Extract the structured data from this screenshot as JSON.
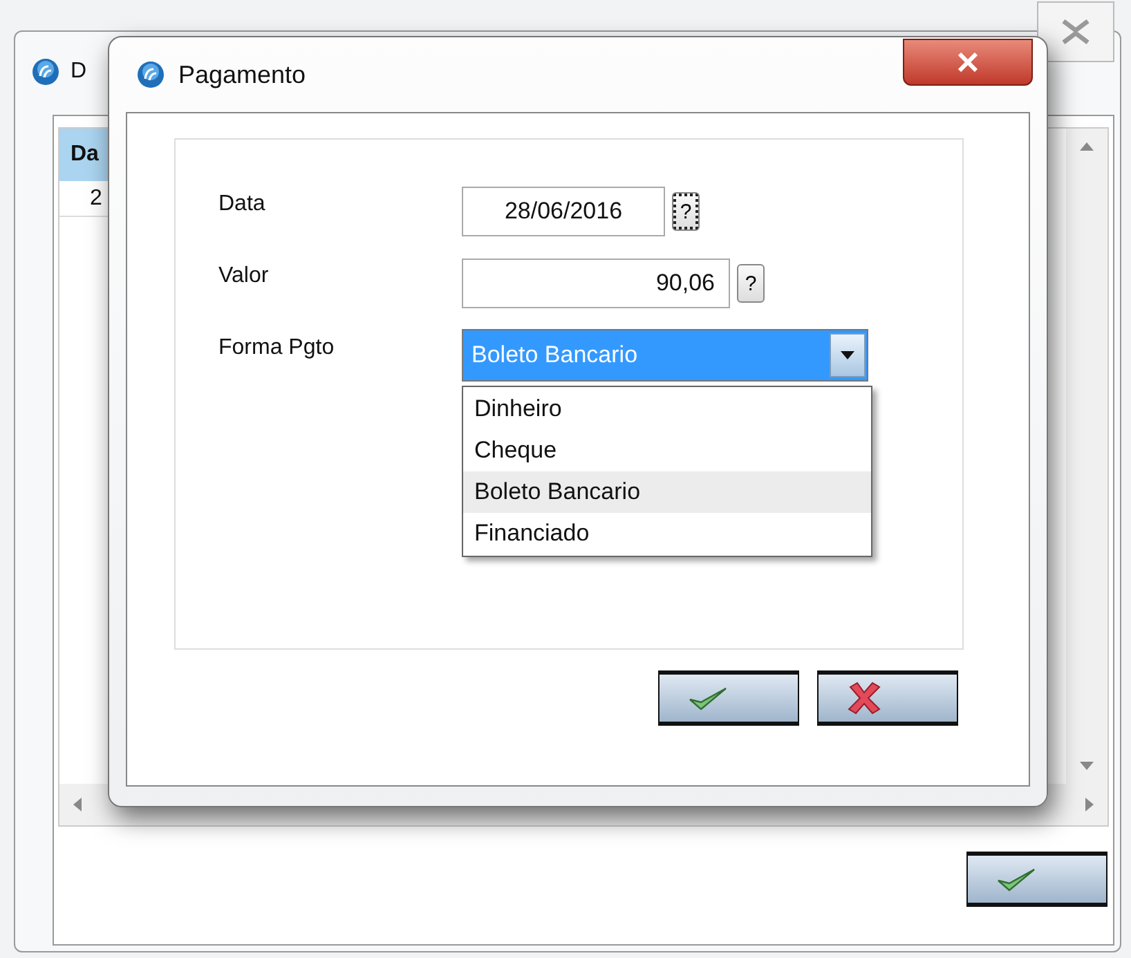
{
  "background_window": {
    "title": "D",
    "table": {
      "columns": [
        "Da"
      ],
      "rows": [
        [
          "2"
        ]
      ]
    },
    "buttons": [
      {
        "kind": "ok"
      }
    ]
  },
  "dialog": {
    "title": "Pagamento",
    "fields": [
      {
        "kind": "date",
        "label": "Data",
        "value": "28/06/2016",
        "help": "?",
        "help_focused": true
      },
      {
        "kind": "number",
        "label": "Valor",
        "value": "90,06",
        "help": "?",
        "help_focused": false
      },
      {
        "kind": "select",
        "label": "Forma Pgto",
        "value": "Boleto Bancario",
        "expanded": true,
        "options": [
          {
            "label": "Dinheiro",
            "selected": false
          },
          {
            "label": "Cheque",
            "selected": false
          },
          {
            "label": "Boleto Bancario",
            "selected": true
          },
          {
            "label": "Financiado",
            "selected": false
          }
        ]
      }
    ],
    "buttons": [
      {
        "kind": "ok"
      },
      {
        "kind": "cancel"
      }
    ]
  }
}
